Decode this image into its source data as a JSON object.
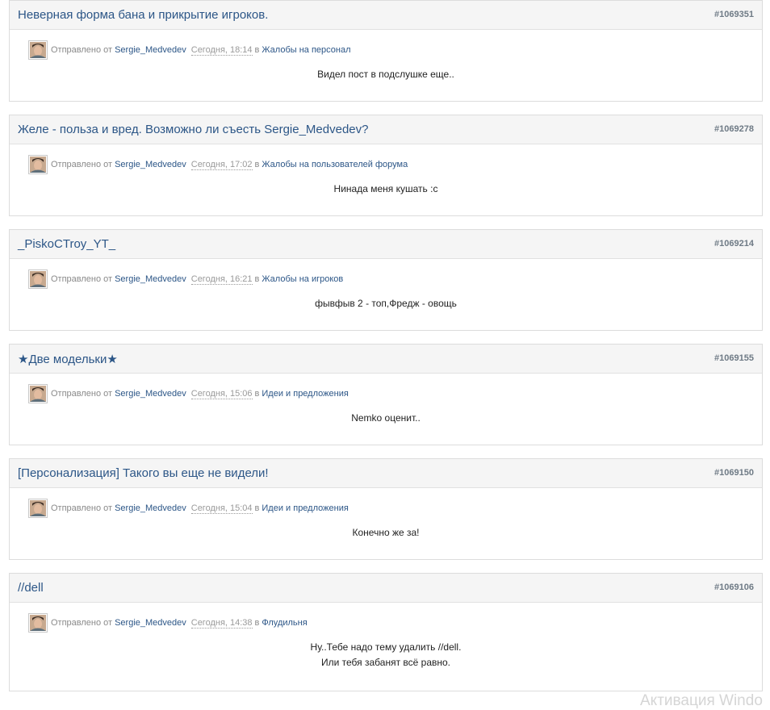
{
  "posts": [
    {
      "title": "Неверная форма бана и прикрытие игроков.",
      "id": "#1069351",
      "sent_label": "Отправлено от",
      "author": "Sergie_Medvedev",
      "time": "Сегодня, 18:14",
      "in_label": "в",
      "forum": "Жалобы на персонал",
      "body": [
        "Видел пост в подслушке еще.."
      ]
    },
    {
      "title": "Желе - польза и вред. Возможно ли съесть Sergie_Medvedev?",
      "id": "#1069278",
      "sent_label": "Отправлено от",
      "author": "Sergie_Medvedev",
      "time": "Сегодня, 17:02",
      "in_label": "в",
      "forum": "Жалобы на пользователей форума",
      "body": [
        "Нинада меня кушать :c"
      ]
    },
    {
      "title": "_PiskoCTroy_YT_",
      "id": "#1069214",
      "sent_label": "Отправлено от",
      "author": "Sergie_Medvedev",
      "time": "Сегодня, 16:21",
      "in_label": "в",
      "forum": "Жалобы на игроков",
      "body": [
        "фывфыв 2 - топ,Фредж - овощь"
      ]
    },
    {
      "title": "★Две модельки★",
      "id": "#1069155",
      "sent_label": "Отправлено от",
      "author": "Sergie_Medvedev",
      "time": "Сегодня, 15:06",
      "in_label": "в",
      "forum": "Идеи и предложения",
      "body": [
        "Nemko оценит.."
      ]
    },
    {
      "title": "[Персонализация] Такого вы еще не видели!",
      "id": "#1069150",
      "sent_label": "Отправлено от",
      "author": "Sergie_Medvedev",
      "time": "Сегодня, 15:04",
      "in_label": "в",
      "forum": "Идеи и предложения",
      "body": [
        "Конечно же за!"
      ]
    },
    {
      "title": "//dell",
      "id": "#1069106",
      "sent_label": "Отправлено от",
      "author": "Sergie_Medvedev",
      "time": "Сегодня, 14:38",
      "in_label": "в",
      "forum": "Флудильня",
      "body": [
        "Ну..Тебе надо тему удалить //dell.",
        "Или тебя забанят всё равно."
      ]
    }
  ],
  "watermark": "Активация Windo",
  "colors": {
    "link": "#2c5687",
    "header_bg": "#f5f5f5",
    "border": "#dcdcdc",
    "muted": "#8a8a8a"
  },
  "icons": {
    "avatar": "user-avatar-photo"
  }
}
